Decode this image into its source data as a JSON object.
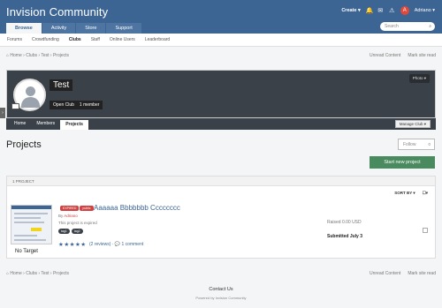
{
  "header": {
    "brand": "Invision Community",
    "create_label": "Create ▾",
    "user_initial": "A",
    "user_label": "Adriano ▾",
    "tabs": [
      "Browse",
      "Activity",
      "Store",
      "Support"
    ],
    "search_placeholder": "Search"
  },
  "subnav": [
    "Forums",
    "Crowdfunding",
    "Clubs",
    "Staff",
    "Online Users",
    "Leaderboard"
  ],
  "breadcrumb": "⌂ Home › Clubs › Test › Projects",
  "breadcrumb_right": {
    "unread": "Unread Content",
    "mark_read": "Mark site read"
  },
  "club": {
    "name": "Test",
    "type": "Open Club",
    "members": "1 member",
    "photo_label": "Photo ▾",
    "tabs": [
      "Home",
      "Members",
      "Projects"
    ],
    "manage_label": "Manage Club ▾"
  },
  "page": {
    "title": "Projects",
    "follow_label": "Follow",
    "follow_count": "0",
    "new_project_label": "Start new project"
  },
  "list": {
    "count_label": "1 PROJECT",
    "sort_label": "SORT BY ▾",
    "item": {
      "target_label": "No Target",
      "status_tags": [
        "EXPIRED",
        "public"
      ],
      "title": "Aaaaaa Bbbbbbb Cccccccc",
      "by_prefix": "By",
      "author": "Adriano",
      "expired_text": "This project is expired",
      "tags": [
        "tag1",
        "tag2"
      ],
      "stars": "★★★★★",
      "reviews": "(2 reviews) · 💬 1 comment",
      "raised": "Raised 0.00 USD",
      "submitted": "Submitted July 3"
    }
  },
  "footer": {
    "contact": "Contact Us",
    "powered": "Powered by Invision Community"
  }
}
